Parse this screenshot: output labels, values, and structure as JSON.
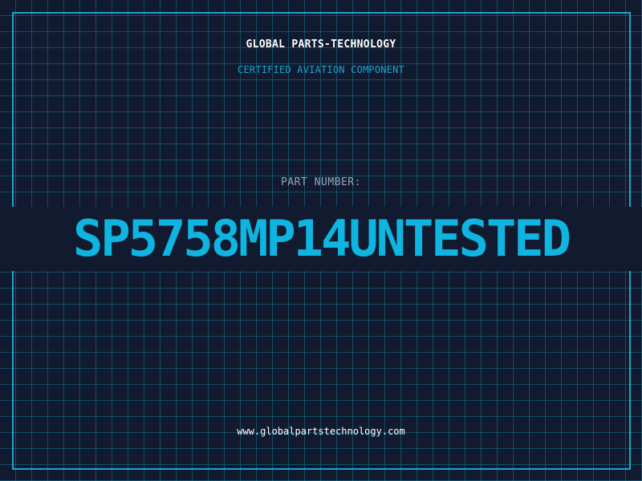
{
  "header": {
    "company": "GLOBAL PARTS-TECHNOLOGY",
    "subtitle": "CERTIFIED AVIATION COMPONENT"
  },
  "part": {
    "label": "PART NUMBER:",
    "number": "SP5758MP14UNTESTED"
  },
  "footer": {
    "website": "www.globalpartstechnology.com"
  },
  "colors": {
    "background": "#111a2e",
    "accent": "#1aa6cf",
    "part_number": "#0fb5e0",
    "text": "#ffffff",
    "label": "#9aa6b8"
  }
}
